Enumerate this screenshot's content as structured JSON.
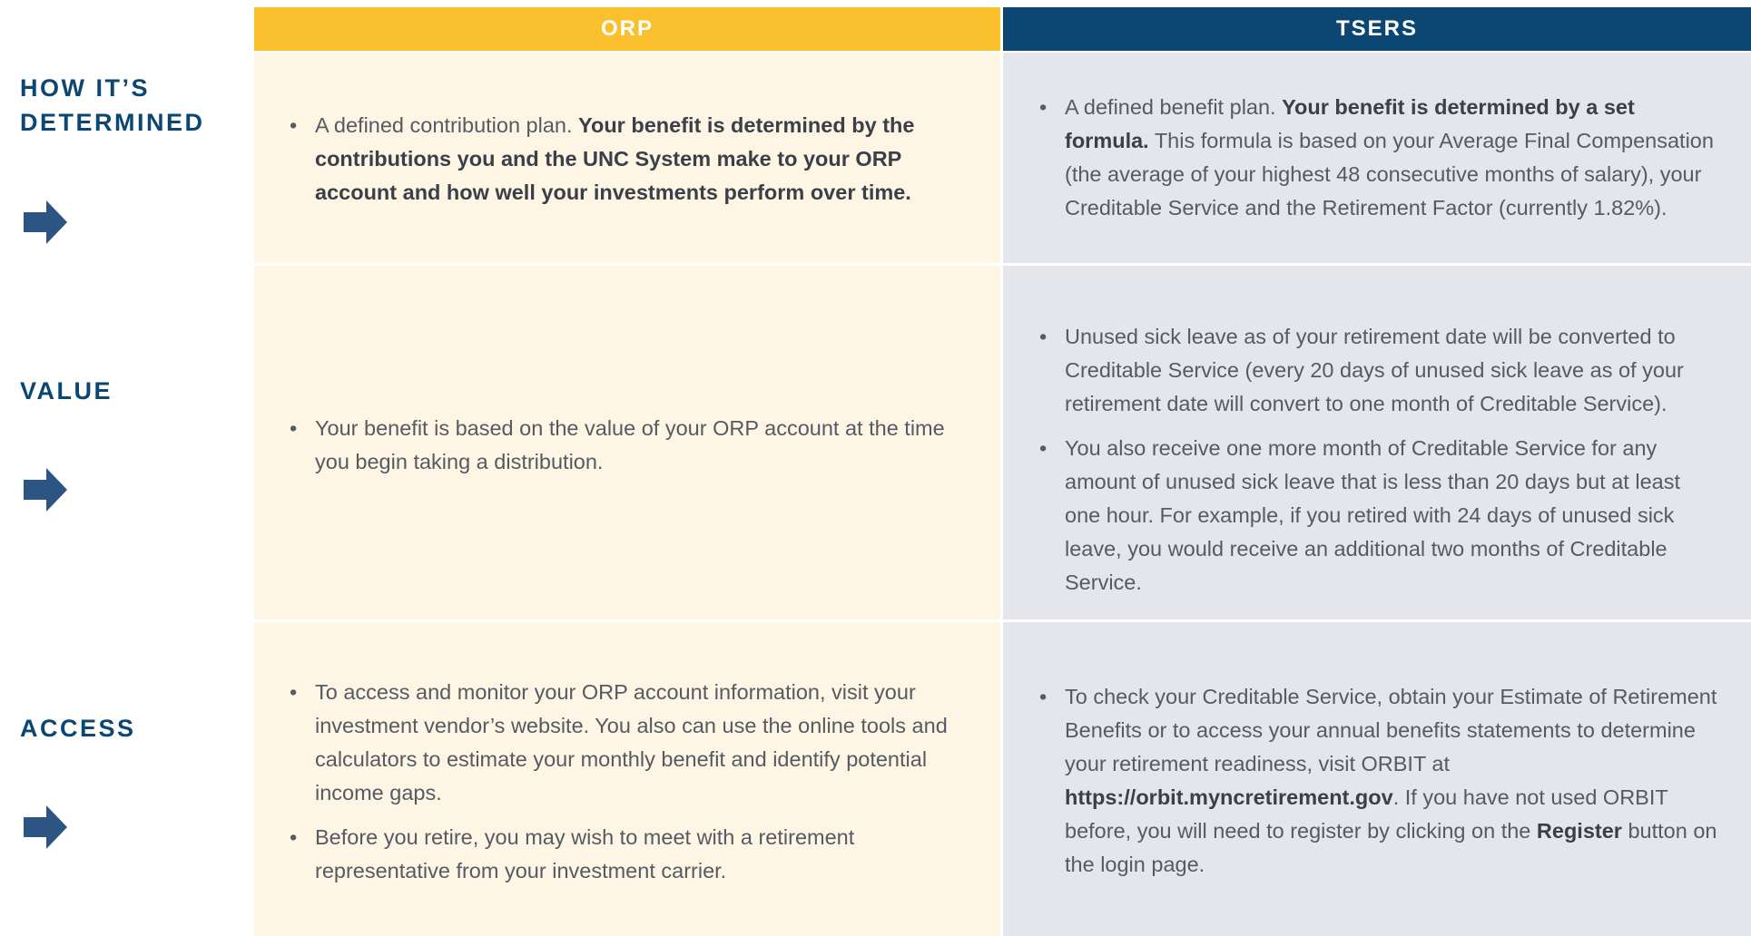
{
  "columns": {
    "orp": "ORP",
    "tsers": "TSERS"
  },
  "rows": {
    "determined": {
      "label_line1": "HOW IT’S",
      "label_line2": "DETERMINED",
      "orp": {
        "plain": " A defined contribution plan. ",
        "bold": "Your benefit is determined by the contributions you and the UNC System make to your ORP account and how well your investments perform over time."
      },
      "tsers": {
        "plain": "A defined benefit plan. ",
        "bold": "Your benefit is determined by a set formula.",
        "rest": " This formula is based on your Average Final Compensation (the average of your highest 48 consecutive months of salary), your Creditable Service and the Retirement Factor (currently 1.82%)."
      }
    },
    "value": {
      "label": "VALUE",
      "orp": {
        "item1": "Your benefit is based on the value of your ORP account at the time you begin taking a distribution."
      },
      "tsers": {
        "item1": "Unused sick leave as of your retirement date will be converted to Creditable Service (every 20 days of unused sick leave as of your retirement date will convert to one month of Creditable Service).",
        "item2": "You also receive one more month of Creditable Service for any amount of unused sick leave that is less than 20 days but at least one hour. For example, if you retired with 24 days of unused sick leave, you would receive an additional two months of Creditable Service."
      }
    },
    "access": {
      "label": "ACCESS",
      "orp": {
        "item1": "To access and monitor your ORP account information, visit your investment vendor’s website. You also can use the online tools and calculators to estimate your monthly benefit and identify potential income gaps.",
        "item2": "Before you retire, you may wish to meet with a retirement representative from your investment carrier."
      },
      "tsers": {
        "part1": "To check your Creditable Service, obtain your Estimate of Retirement Benefits or to access your annual benefits statements to determine your retirement readiness, visit ORBIT at ",
        "link": "https://orbit.myncretirement.gov",
        "part2": ". If you have not used ORBIT before, you will need to register by clicking on the ",
        "button_word": "Register",
        "part3": " button on the login page."
      }
    }
  },
  "bullet": "•",
  "icons": {
    "row_arrow": "arrow-right-icon"
  },
  "colors": {
    "orp_header": "#FBC02D",
    "tsers_header": "#0B4772",
    "orp_cell": "#FEF5E4",
    "tsers_cell": "#E4E6EB",
    "label": "#0B4772",
    "arrow": "#2C5584"
  }
}
